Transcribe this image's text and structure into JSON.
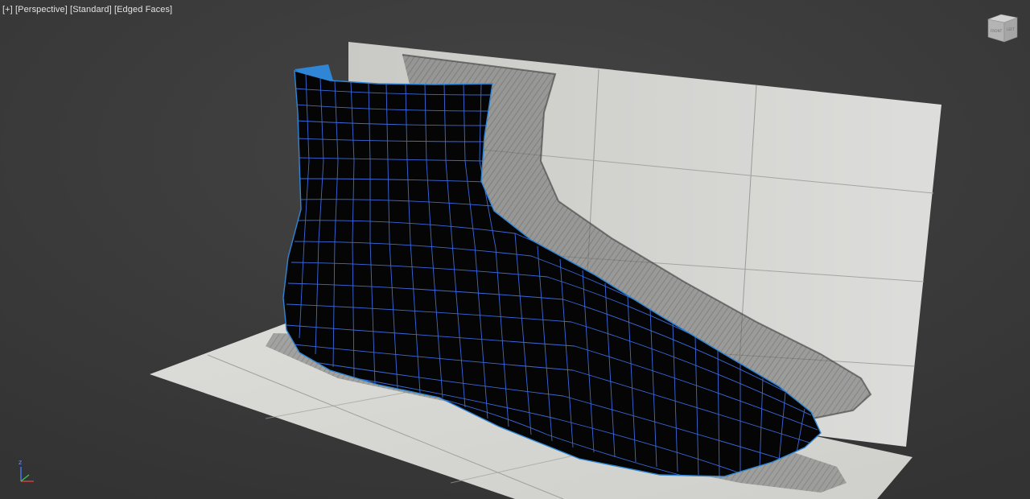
{
  "viewport": {
    "label_menu": {
      "plus": "[+]",
      "view": "[Perspective]",
      "shading": "[Standard]",
      "display": "[Edged Faces]"
    },
    "viewcube": {
      "face": "FRONT",
      "side": "LEFT",
      "icon": "viewcube-icon"
    },
    "axis_tripod": {
      "z_label": "z",
      "icon": "axis-tripod-icon"
    },
    "colors": {
      "background": "#3b3b3b",
      "mesh_fill": "#050505",
      "mesh_wire": "#3f6fe8",
      "selection_edge": "#2f86d6",
      "reference_plane": "#d8d8d4",
      "sketch": "#4a4a4a"
    }
  }
}
